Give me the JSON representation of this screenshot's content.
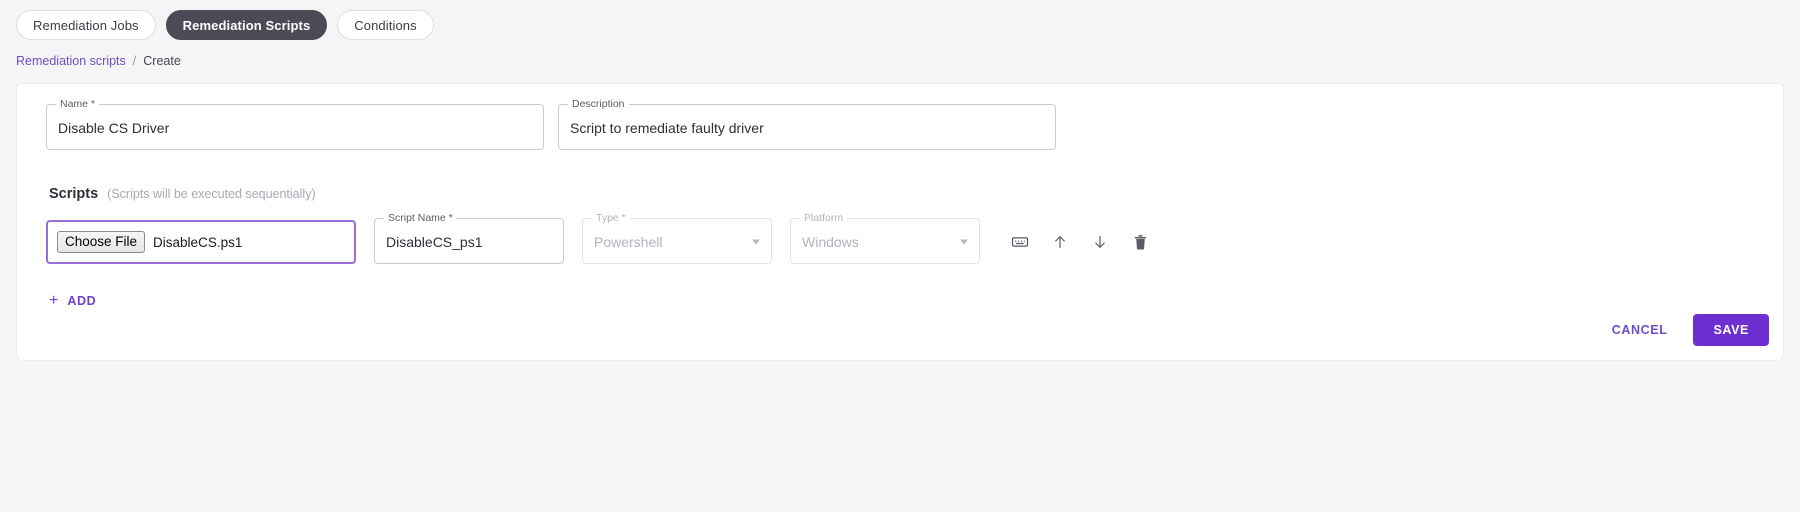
{
  "tabs": [
    {
      "label": "Remediation Jobs",
      "active": false
    },
    {
      "label": "Remediation Scripts",
      "active": true
    },
    {
      "label": "Conditions",
      "active": false
    }
  ],
  "breadcrumb": {
    "parent": "Remediation scripts",
    "separator": "/",
    "current": "Create"
  },
  "form": {
    "name": {
      "label": "Name *",
      "value": "Disable CS Driver"
    },
    "description": {
      "label": "Description",
      "value": "Script to remediate faulty driver"
    }
  },
  "scripts_section": {
    "title": "Scripts",
    "hint": "(Scripts will be executed sequentially)",
    "row": {
      "file": {
        "button_label": "Choose File",
        "filename": "DisableCS.ps1"
      },
      "script_name": {
        "label": "Script Name *",
        "value": "DisableCS_ps1"
      },
      "type": {
        "label": "Type *",
        "value": "Powershell"
      },
      "platform": {
        "label": "Platform",
        "value": "Windows"
      },
      "actions": [
        {
          "name": "script-content-icon"
        },
        {
          "name": "move-up-icon"
        },
        {
          "name": "move-down-icon"
        },
        {
          "name": "delete-icon"
        }
      ]
    },
    "add": {
      "plus": "+",
      "label": "ADD"
    }
  },
  "footer": {
    "cancel_label": "CANCEL",
    "save_label": "SAVE"
  },
  "colors": {
    "accent_purple": "#6d2fd0",
    "link_purple": "#6d4fc4",
    "focus_border": "#9a6fd4",
    "active_chip": "#4b4a55",
    "page_bg": "#f5f5f7"
  }
}
